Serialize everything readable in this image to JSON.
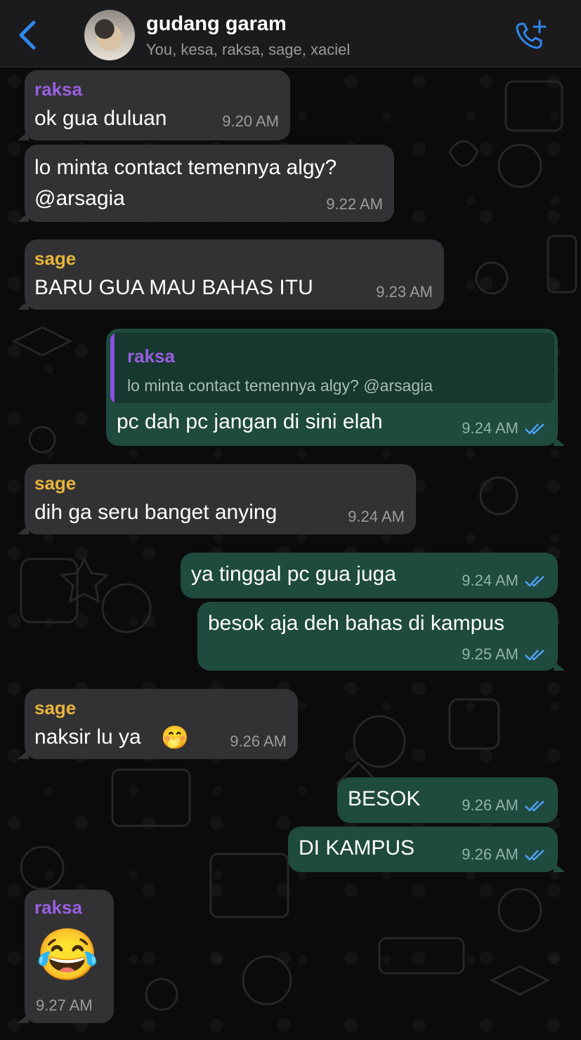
{
  "header": {
    "title": "gudang garam",
    "subtitle": "You, kesa, raksa, sage, xaciel"
  },
  "colors": {
    "accent": "#2f86eb",
    "incoming_bubble": "#323234",
    "outgoing_bubble": "#1f4a3e",
    "raksa_name": "#9a5fe0",
    "sage_name": "#e8b43a"
  },
  "messages": [
    {
      "sender": "raksa",
      "text": "ok gua duluan",
      "time": "9.20 AM"
    },
    {
      "line1": "lo minta contact temennya algy?",
      "line2": "@arsagia",
      "time": "9.22 AM"
    },
    {
      "sender": "sage",
      "text": "BARU GUA MAU BAHAS ITU",
      "time": "9.23 AM"
    },
    {
      "quote_sender": "raksa",
      "quote_text": "lo minta contact temennya algy? @arsagia",
      "text": "pc dah pc jangan di sini elah",
      "time": "9.24 AM",
      "status": "read"
    },
    {
      "sender": "sage",
      "text": "dih ga seru banget anying",
      "time": "9.24 AM"
    },
    {
      "text": "ya tinggal pc gua juga",
      "time": "9.24 AM",
      "status": "read"
    },
    {
      "text": "besok aja deh bahas di kampus",
      "time": "9.25 AM",
      "status": "read"
    },
    {
      "sender": "sage",
      "text": "naksir lu ya",
      "emoji": "🤭",
      "time": "9.26 AM"
    },
    {
      "text": "BESOK",
      "time": "9.26 AM",
      "status": "read"
    },
    {
      "text": "DI KAMPUS",
      "time": "9.26 AM",
      "status": "read"
    },
    {
      "sender": "raksa",
      "emoji": "😂",
      "time": "9.27 AM"
    }
  ]
}
